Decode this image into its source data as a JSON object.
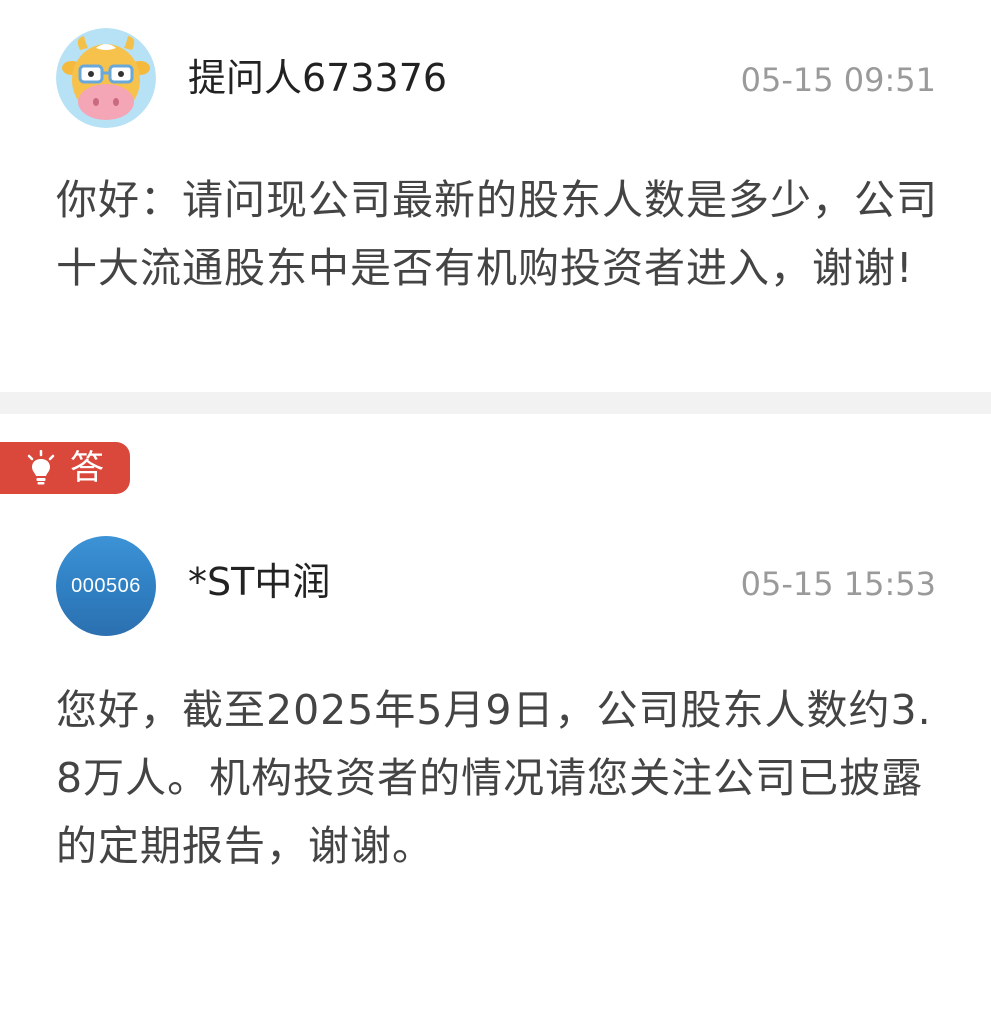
{
  "question": {
    "user_name": "提问人673376",
    "timestamp": "05-15 09:51",
    "text": "你好：请问现公司最新的股东人数是多少，公司十大流通股东中是否有机购投资者进入，谢谢!"
  },
  "answer": {
    "tag_label": "答",
    "company_name": "*ST中润",
    "company_code": "000506",
    "timestamp": "05-15 15:53",
    "text": "您好，截至2025年5月9日，公司股东人数约3.8万人。机构投资者的情况请您关注公司已披露的定期报告，谢谢。"
  },
  "colors": {
    "accent_red": "#d9483b",
    "avatar_blue": "#2f7fc2",
    "timestamp_gray": "#9a9a9a",
    "divider": "#f2f2f2"
  },
  "icons": {
    "user_avatar": "cartoon-cow-avatar-icon",
    "answer_tag": "lightbulb-icon"
  }
}
